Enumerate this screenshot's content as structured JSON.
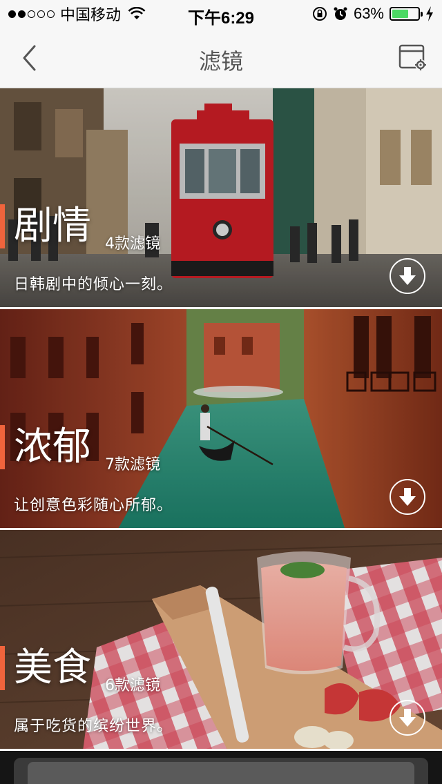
{
  "status_bar": {
    "carrier": "中国移动",
    "time": "下午6:29",
    "battery_percent_label": "63%",
    "battery_level": 0.63,
    "signal_bars_filled": 2,
    "signal_bars_total": 5
  },
  "nav": {
    "title": "滤镜",
    "back_icon": "chevron-left-icon",
    "settings_icon": "window-gear-icon"
  },
  "filters": [
    {
      "title": "剧情",
      "count_label": "4款滤镜",
      "description": "日韩剧中的倾心一刻。",
      "download_icon": "download-arrow-icon"
    },
    {
      "title": "浓郁",
      "count_label": "7款滤镜",
      "description": "让创意色彩随心所郁。",
      "download_icon": "download-arrow-icon"
    },
    {
      "title": "美食",
      "count_label": "6款滤镜",
      "description": "属于吃货的缤纷世界。",
      "download_icon": "download-arrow-icon"
    }
  ],
  "colors": {
    "accent": "#f0643c",
    "nav_background": "#f7f7f7",
    "battery_fill": "#4cd964"
  }
}
